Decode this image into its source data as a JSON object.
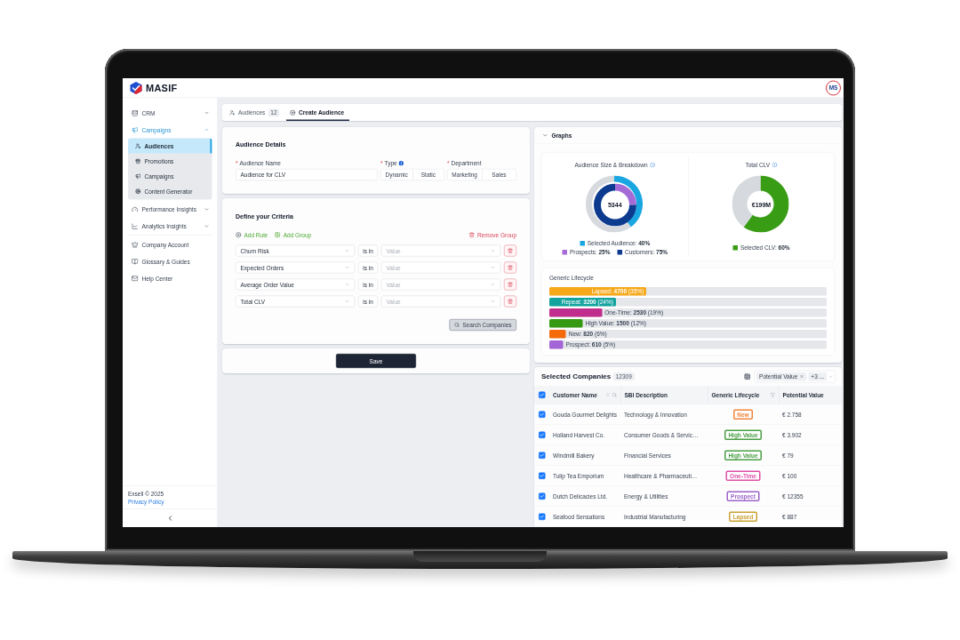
{
  "top_bar": {
    "logo_text": "MASIF",
    "avatar": "MS"
  },
  "sidebar": {
    "groups": [
      {
        "label": "CRM",
        "selected": false,
        "expanded": false
      },
      {
        "label": "Campaigns",
        "selected": true,
        "expanded": true,
        "children": [
          {
            "label": "Audiences",
            "selected": true
          },
          {
            "label": "Promotions",
            "selected": false
          },
          {
            "label": "Campaigns",
            "selected": false
          },
          {
            "label": "Content Generator",
            "selected": false
          }
        ]
      },
      {
        "label": "Performance Insights",
        "selected": false,
        "expanded": false
      },
      {
        "label": "Analytics Insights",
        "selected": false,
        "expanded": false
      }
    ],
    "links": [
      {
        "label": "Company Account",
        "selected": false
      },
      {
        "label": "Glossary & Guides",
        "selected": false
      },
      {
        "label": "Help Center",
        "selected": false
      }
    ],
    "footer": {
      "copyright": "Exsell © 2025",
      "link": "Privacy Policy"
    }
  },
  "tabs": [
    {
      "label": "Audiences",
      "badge": "12",
      "selected": false
    },
    {
      "label": "Create Audience",
      "selected": true
    }
  ],
  "audience_details": {
    "title": "Audience Details",
    "fields": [
      {
        "kind": "text",
        "required_mark": "*",
        "label": "Audience Name",
        "value": "Audience for CLV"
      },
      {
        "kind": "segmented",
        "required_mark": "*",
        "label": "Type",
        "info": true,
        "options": [
          {
            "label": "Dynamic",
            "selected": false
          },
          {
            "label": "Static",
            "selected": false
          }
        ]
      },
      {
        "kind": "segmented",
        "required_mark": "*",
        "label": "Department",
        "options": [
          {
            "label": "Marketing",
            "selected": false
          },
          {
            "label": "Sales",
            "selected": false
          }
        ]
      }
    ]
  },
  "criteria": {
    "title": "Define your Criteria",
    "actions": [
      {
        "kind": "add_rule",
        "label": "Add Rule"
      },
      {
        "kind": "add_group",
        "label": "Add Group"
      },
      {
        "kind": "remove_group",
        "label": "Remove Group"
      }
    ],
    "rules": [
      {
        "field": "Churn Risk",
        "operator": "is in",
        "placeholder": "Value"
      },
      {
        "field": "Expected Orders",
        "operator": "is in",
        "placeholder": "Value"
      },
      {
        "field": "Average Order Value",
        "operator": "is in",
        "placeholder": "Value"
      },
      {
        "field": "Total CLV",
        "operator": "is in",
        "placeholder": "Value"
      }
    ],
    "search_button": "Search Companies"
  },
  "save_button": "Save",
  "graphs": {
    "title": "Graphs",
    "expanded": true,
    "donuts": [
      {
        "info": true,
        "center_label": "5344",
        "legend_separator": ":",
        "chart_data": [
          {
            "type": "donut",
            "title": "Audience Size & Breakdown",
            "categories": [
              "Selected Audience",
              null
            ],
            "values": [
              40,
              60
            ],
            "value_labels": [
              "40%",
              null
            ],
            "colors": [
              "#1aa7e1",
              "#d6d9de"
            ]
          },
          {
            "type": "donut",
            "categories": [
              "Prospects",
              "Customers"
            ],
            "values": [
              25,
              75
            ],
            "value_labels": [
              "25%",
              "75%"
            ],
            "colors": [
              "#a46bd7",
              "#0c3a8e"
            ]
          }
        ]
      },
      {
        "info": true,
        "center_label": "€199M",
        "legend_separator": ":",
        "chart_data": {
          "type": "donut",
          "title": "Total CLV",
          "categories": [
            "Selected CLV",
            null
          ],
          "values": [
            60,
            40
          ],
          "value_labels": [
            "60%",
            null
          ],
          "colors": [
            "#389c15",
            "#d6d9de"
          ]
        }
      }
    ],
    "lifecycle": {
      "title": "Generic Lifecycle",
      "bars": [
        {
          "text": "Lapsed: **4700** (35%)",
          "level": 0.35,
          "color": "#f6a91b"
        },
        {
          "text": "Repeat: **3200** (24%)",
          "level": 0.24,
          "color": "#13a39f"
        },
        {
          "text": "One-Time: **2530** (19%)",
          "level": 0.19,
          "color": "#c12d8c"
        },
        {
          "text": "High Value: **1500** (12%)",
          "level": 0.12,
          "color": "#359a12"
        },
        {
          "text": "New: **820** (6%)",
          "level": 0.06,
          "color": "#f56b0c"
        },
        {
          "text": "Prospect: **610** (5%)",
          "level": 0.05,
          "color": "#a466d6"
        }
      ]
    }
  },
  "companies": {
    "title": "Selected Companies",
    "count": "12309",
    "filter_chips": [
      {
        "label": "Potential Value",
        "removable": true
      },
      {
        "label": "+3 ...",
        "removable": false
      }
    ],
    "all_checked": true,
    "columns": [
      {
        "label": "Customer Name",
        "sortable": true,
        "searchable": true
      },
      {
        "label": "SBI Description"
      },
      {
        "label": "Generic Lifecycle",
        "filterable": true
      },
      {
        "label": "Potential Value"
      }
    ],
    "rows": [
      {
        "checked": true,
        "customer": "Gouda Gourmet Delights",
        "sbi": "Technology & Innovation",
        "lifecycle": {
          "label": "New",
          "color": "#f2843a"
        },
        "value": "€ 2.758"
      },
      {
        "checked": true,
        "customer": "Holland Harvest Co.",
        "sbi": "Consumer Goods & Servic…",
        "lifecycle": {
          "label": "High Value",
          "color": "#4a9e45"
        },
        "value": "€ 3.902"
      },
      {
        "checked": true,
        "customer": "Windmill Bakery",
        "sbi": "Financial Services",
        "lifecycle": {
          "label": "High Value",
          "color": "#4a9e45"
        },
        "value": "€ 79"
      },
      {
        "checked": true,
        "customer": "Tulip Tea Emporium",
        "sbi": "Healthcare & Pharmaceuti…",
        "lifecycle": {
          "label": "One-Time",
          "color": "#de4fa6"
        },
        "value": "€ 100"
      },
      {
        "checked": true,
        "customer": "Dutch Delicacies Ltd.",
        "sbi": "Energy & Utilities",
        "lifecycle": {
          "label": "Prospect",
          "color": "#9b62c9"
        },
        "value": "€ 12355"
      },
      {
        "checked": true,
        "customer": "Seafood Sensations",
        "sbi": "Industrial Manufacturing",
        "lifecycle": {
          "label": "Lapsed",
          "color": "#c9a132"
        },
        "value": "€ 887"
      }
    ]
  }
}
